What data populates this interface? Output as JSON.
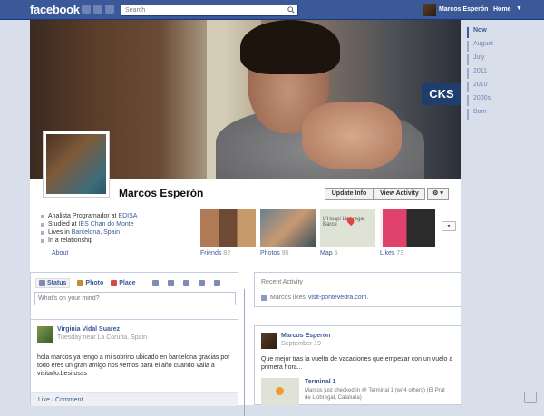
{
  "topbar": {
    "logo": "facebook",
    "search_placeholder": "Search",
    "user_name": "Marcos Esperón",
    "home_label": "Home"
  },
  "profile": {
    "name": "Marcos Esperón",
    "update_info": "Update Info",
    "view_activity": "View Activity",
    "settings_caret": "⚙ ▾",
    "cover_sign": "CKS",
    "info": [
      {
        "prefix": "Analista Programador at ",
        "link": "EDISA"
      },
      {
        "prefix": "Studied at ",
        "link": "IES Chan do Monte"
      },
      {
        "prefix": "Lives in ",
        "link": "Barcelona, Spain"
      },
      {
        "prefix": "In a relationship",
        "link": ""
      }
    ],
    "about": "About"
  },
  "thumbnails": [
    {
      "label": "Friends",
      "count": "82"
    },
    {
      "label": "Photos",
      "count": "95"
    },
    {
      "label": "Map",
      "count": "5"
    },
    {
      "label": "Likes",
      "count": "73"
    }
  ],
  "map_text": "L'Hospi Llobregat   Barce",
  "composer": {
    "status": "Status",
    "photo": "Photo",
    "place": "Place",
    "placeholder": "What's on your mind?"
  },
  "recent": {
    "title": "Recent Activity",
    "prefix": "Marcos likes ",
    "link": "visit-pontevedra.com."
  },
  "post1": {
    "author": "Virginia Vidal Suarez",
    "date": "Tuesday near La Coruña, Spain",
    "text": "hola marcos ya tengo a mi sobrino ubicado en barcelona gracias por todo eres un gran amigo nos vemos para el año cuando valla a visitarlo.besitosss",
    "actions": "Like · Comment"
  },
  "post2": {
    "author": "Marcos Esperón",
    "date": "September 19",
    "text": "Que mejor tras la vuelta de vacaciones que empezar con un vuelo a primera hora...",
    "checkin_title": "Terminal 1",
    "checkin_text": "Marcos just checked in @ Terminal 1 (w/ 4 others) (El Prat de Llobregat, Cataluña)"
  },
  "timeline": [
    "Now",
    "August",
    "July",
    "2011",
    "2010",
    "2000s",
    "Born"
  ]
}
